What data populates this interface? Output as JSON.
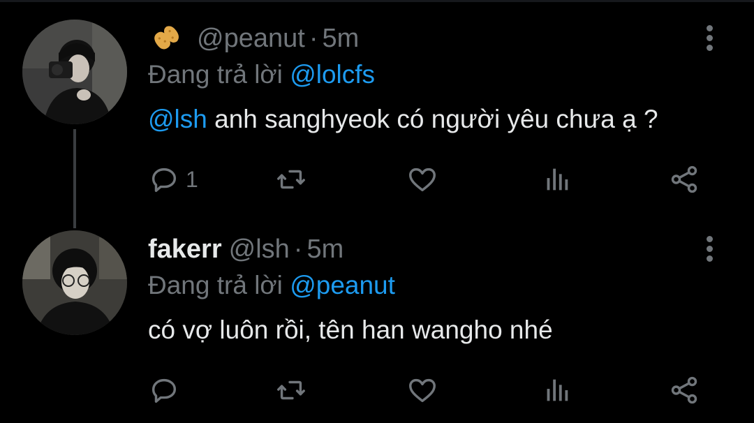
{
  "colors": {
    "background": "#000000",
    "text": "#e7e9ea",
    "secondary": "#71767b",
    "accent": "#1d9bf0"
  },
  "tweets": [
    {
      "emoji": "peanut-emoji",
      "display_name": "",
      "handle": "@peanut",
      "separator": "·",
      "time": "5m",
      "replying_prefix": "Đang trả lời",
      "replying_to": "@lolcfs",
      "mention": "@lsh",
      "text": " anh sanghyeok có người yêu chưa ạ ?",
      "reply_count": "1",
      "icons": [
        "reply-icon",
        "retweet-icon",
        "like-icon",
        "stats-icon",
        "share-icon",
        "more-icon"
      ]
    },
    {
      "display_name": "fakerr",
      "handle": "@lsh",
      "separator": "·",
      "time": "5m",
      "replying_prefix": "Đang trả lời",
      "replying_to": "@peanut",
      "text": "có vợ luôn rồi, tên han wangho nhé",
      "reply_count": "",
      "icons": [
        "reply-icon",
        "retweet-icon",
        "like-icon",
        "stats-icon",
        "share-icon",
        "more-icon"
      ]
    }
  ]
}
